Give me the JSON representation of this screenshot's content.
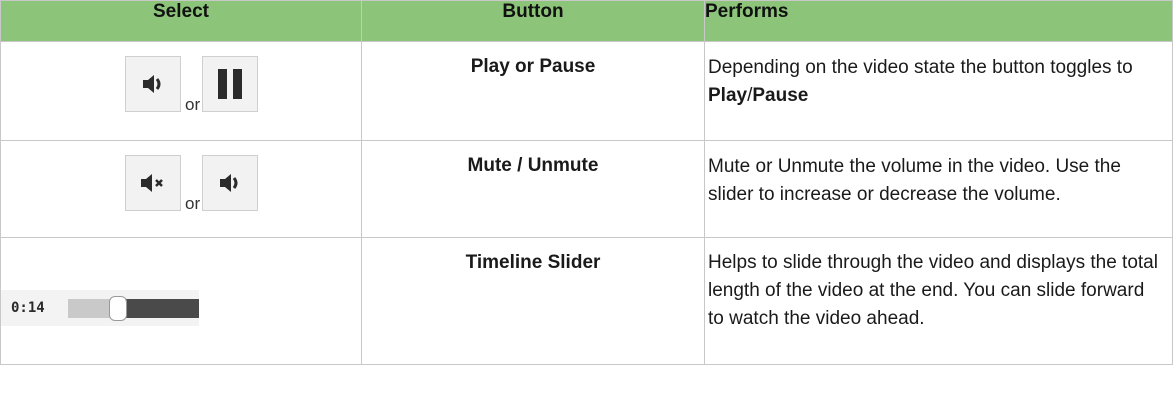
{
  "table": {
    "headers": {
      "select": "Select",
      "button": "Button",
      "performs": "Performs"
    },
    "rows": [
      {
        "button": "Play or Pause",
        "or_text": "or",
        "icons": [
          "speaker-icon",
          "pause-icon"
        ],
        "performs_start": "Depending on the video state the button toggles to ",
        "performs_bold_1": "Play",
        "performs_sep": "/",
        "performs_bold_2": "Pause"
      },
      {
        "button": "Mute / Unmute",
        "or_text": "or",
        "icons": [
          "mute-icon",
          "speaker-icon"
        ],
        "performs": "Mute or Unmute the volume in the video. Use the slider to increase or decrease the volume."
      },
      {
        "button": "Timeline Slider",
        "slider": {
          "time": "0:14",
          "position": 0.38
        },
        "performs": "Helps to slide through the video and displays the total length of the video at the end. You can slide forward to watch the video ahead."
      }
    ]
  },
  "colors": {
    "header_bg": "#8cc47a",
    "border": "#c8c8c8",
    "icon_bg": "#f2f2f2",
    "icon_fg": "#2b2b2b"
  }
}
